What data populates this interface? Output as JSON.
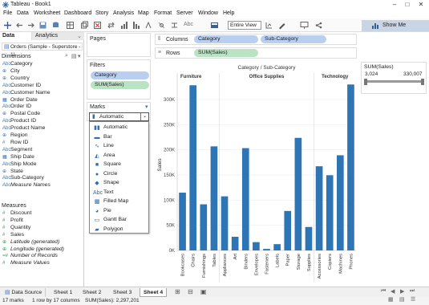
{
  "window": {
    "title": "Tableau - Book1"
  },
  "menu": [
    "File",
    "Data",
    "Worksheet",
    "Dashboard",
    "Story",
    "Analysis",
    "Map",
    "Format",
    "Server",
    "Window",
    "Help"
  ],
  "toolbar": {
    "fit": "Entire View",
    "abc": "Abc",
    "show_me": "Show Me"
  },
  "left": {
    "tab_data": "Data",
    "tab_analytics": "Analytics",
    "datasource": "Orders (Sample - Superstore - 1)",
    "dimensions_title": "Dimensions",
    "dimensions": [
      {
        "icon": "Abc",
        "name": "Category"
      },
      {
        "icon": "⊕",
        "name": "City"
      },
      {
        "icon": "⊕",
        "name": "Country"
      },
      {
        "icon": "Abc",
        "name": "Customer ID"
      },
      {
        "icon": "Abc",
        "name": "Customer Name"
      },
      {
        "icon": "▦",
        "name": "Order Date"
      },
      {
        "icon": "Abc",
        "name": "Order ID"
      },
      {
        "icon": "⊕",
        "name": "Postal Code"
      },
      {
        "icon": "Abc",
        "name": "Product ID"
      },
      {
        "icon": "Abc",
        "name": "Product Name"
      },
      {
        "icon": "⊕",
        "name": "Region"
      },
      {
        "icon": "#",
        "name": "Row ID"
      },
      {
        "icon": "Abc",
        "name": "Segment"
      },
      {
        "icon": "▦",
        "name": "Ship Date"
      },
      {
        "icon": "Abc",
        "name": "Ship Mode"
      },
      {
        "icon": "⊕",
        "name": "State"
      },
      {
        "icon": "Abc",
        "name": "Sub-Category"
      },
      {
        "icon": "Abc",
        "name": "Measure Names"
      }
    ],
    "measures_title": "Measures",
    "measures": [
      {
        "icon": "#",
        "name": "Discount"
      },
      {
        "icon": "#",
        "name": "Profit"
      },
      {
        "icon": "#",
        "name": "Quantity"
      },
      {
        "icon": "#",
        "name": "Sales"
      },
      {
        "icon": "⊕",
        "name": "Latitude (generated)"
      },
      {
        "icon": "⊕",
        "name": "Longitude (generated)"
      },
      {
        "icon": "=#",
        "name": "Number of Records"
      },
      {
        "icon": "#",
        "name": "Measure Values"
      }
    ]
  },
  "cards": {
    "pages": "Pages",
    "filters": "Filters",
    "filter_pills": [
      "Category",
      "SUM(Sales)"
    ],
    "marks": "Marks",
    "marks_selected": "Automatic",
    "marks_options": [
      {
        "glyph": "▮▮",
        "label": "Automatic"
      },
      {
        "glyph": "▬",
        "label": "Bar"
      },
      {
        "glyph": "∿",
        "label": "Line"
      },
      {
        "glyph": "◭",
        "label": "Area"
      },
      {
        "glyph": "■",
        "label": "Square"
      },
      {
        "glyph": "●",
        "label": "Circle"
      },
      {
        "glyph": "◆",
        "label": "Shape"
      },
      {
        "glyph": "Abc",
        "label": "Text"
      },
      {
        "glyph": "▩",
        "label": "Filled Map"
      },
      {
        "glyph": "◕",
        "label": "Pie"
      },
      {
        "glyph": "▭",
        "label": "Gantt Bar"
      },
      {
        "glyph": "▰",
        "label": "Polygon"
      }
    ]
  },
  "shelves": {
    "columns": "Columns",
    "rows": "Rows",
    "col_pills": [
      "Category",
      "Sub-Category"
    ],
    "row_pills": [
      "SUM(Sales)"
    ]
  },
  "legend": {
    "title": "SUM(Sales)",
    "min": "3,024",
    "max": "330,007"
  },
  "chart_data": {
    "type": "bar",
    "title": "Category / Sub-Category",
    "ylabel": "Sales",
    "ylim": [
      0,
      340000
    ],
    "yticks": [
      0,
      50000,
      100000,
      150000,
      200000,
      250000,
      300000
    ],
    "yticklabels": [
      "0K",
      "50K",
      "100K",
      "150K",
      "200K",
      "250K",
      "300K"
    ],
    "color": "#2e75b6",
    "groups": [
      {
        "name": "Furniture",
        "categories": [
          "Bookcases",
          "Chairs",
          "Furnishings",
          "Tables"
        ],
        "values": [
          114880,
          328449,
          91705,
          206966
        ]
      },
      {
        "name": "Office Supplies",
        "categories": [
          "Appliances",
          "Art",
          "Binders",
          "Envelopes",
          "Fasteners",
          "Labels",
          "Paper",
          "Storage",
          "Supplies"
        ],
        "values": [
          107532,
          27119,
          203413,
          16476,
          3024,
          12486,
          78479,
          223844,
          46674
        ]
      },
      {
        "name": "Technology",
        "categories": [
          "Accessories",
          "Copiers",
          "Machines",
          "Phones"
        ],
        "values": [
          167380,
          149528,
          189239,
          330007
        ]
      }
    ]
  },
  "sheets": {
    "data_source": "Data Source",
    "tabs": [
      "Sheet 1",
      "Sheet 2",
      "Sheet 3",
      "Sheet 4"
    ],
    "active": "Sheet 4"
  },
  "status": {
    "marks": "17 marks",
    "dims": "1 row by 17 columns",
    "sum": "SUM(Sales): 2,297,201"
  }
}
